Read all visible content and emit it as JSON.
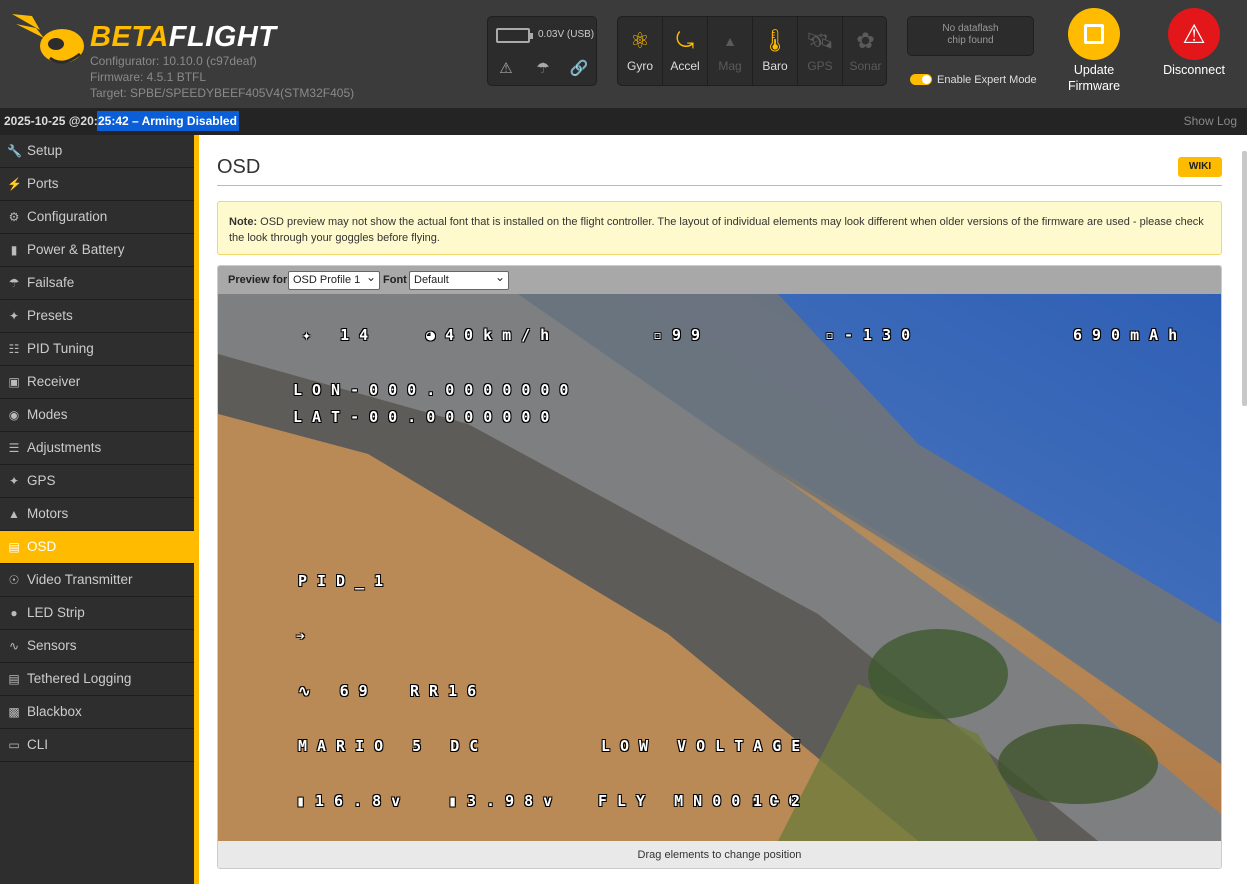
{
  "app": {
    "logo_beta": "BETA",
    "logo_flight": "FLIGHT",
    "configurator": "Configurator: 10.10.0 (c97deaf)",
    "firmware": "Firmware: 4.5.1 BTFL",
    "target": "Target: SPBE/SPEEDYBEEF405V4(STM32F405)"
  },
  "battery": {
    "voltage": "0.03V (USB)"
  },
  "sensors": [
    {
      "label": "Gyro",
      "icon": "gyro-icon",
      "active": true
    },
    {
      "label": "Accel",
      "icon": "accel-icon",
      "active": true
    },
    {
      "label": "Mag",
      "icon": "mag-icon",
      "active": false
    },
    {
      "label": "Baro",
      "icon": "baro-icon",
      "active": true
    },
    {
      "label": "GPS",
      "icon": "gps-icon",
      "active": false
    },
    {
      "label": "Sonar",
      "icon": "sonar-icon",
      "active": false
    }
  ],
  "dataflash": {
    "line1": "No dataflash",
    "line2": "chip found"
  },
  "expert_mode": {
    "label": "Enable Expert Mode",
    "enabled": true
  },
  "header_buttons": {
    "update_line1": "Update",
    "update_line2": "Firmware",
    "disconnect": "Disconnect"
  },
  "statusbar": {
    "date": "2025-10-25 @20:",
    "time_status": "25:42 – Arming Disabled",
    "show_log": "Show Log"
  },
  "sidebar": {
    "items": [
      {
        "label": "Setup",
        "icon": "wrench-icon"
      },
      {
        "label": "Ports",
        "icon": "plug-icon"
      },
      {
        "label": "Configuration",
        "icon": "gear-icon"
      },
      {
        "label": "Power & Battery",
        "icon": "battery-icon"
      },
      {
        "label": "Failsafe",
        "icon": "parachute-icon"
      },
      {
        "label": "Presets",
        "icon": "magic-icon"
      },
      {
        "label": "PID Tuning",
        "icon": "sitemap-icon"
      },
      {
        "label": "Receiver",
        "icon": "robot-icon"
      },
      {
        "label": "Modes",
        "icon": "toggle-icon"
      },
      {
        "label": "Adjustments",
        "icon": "sliders-icon"
      },
      {
        "label": "GPS",
        "icon": "satellite-icon"
      },
      {
        "label": "Motors",
        "icon": "motor-icon"
      },
      {
        "label": "OSD",
        "icon": "osd-icon",
        "active": true
      },
      {
        "label": "Video Transmitter",
        "icon": "broadcast-icon"
      },
      {
        "label": "LED Strip",
        "icon": "led-icon"
      },
      {
        "label": "Sensors",
        "icon": "pulse-icon"
      },
      {
        "label": "Tethered Logging",
        "icon": "log-icon"
      },
      {
        "label": "Blackbox",
        "icon": "blackbox-icon"
      },
      {
        "label": "CLI",
        "icon": "terminal-icon"
      }
    ]
  },
  "main": {
    "title": "OSD",
    "wiki_label": "WIKI",
    "note_bold": "Note:",
    "note_text": " OSD preview may not show the actual font that is installed on the flight controller. The layout of individual elements may look different when older versions of the firmware are used - please check the look through your goggles before flying.",
    "preview_for_label": "Preview for",
    "profile_value": "OSD Profile 1",
    "font_label": "Font",
    "font_value": "Default",
    "footer": "Drag elements to change position"
  },
  "osd_elements": {
    "sats": "14",
    "speed": "40",
    "link_quality": "99",
    "rssi_dbm": "-130",
    "mah": "690",
    "lon": "-000.0000000",
    "lat": "-00.0000000",
    "pid_profile": "PID_1",
    "throttle": "69",
    "rates": "16",
    "craft_name": "MARIO 5 DC",
    "warning": "LOW VOLTAGE",
    "main_voltage": "16.8v",
    "cell_voltage": "3.98v",
    "fly_time": "00:00",
    "pilot_count": "1-2",
    "unit_kmh": "km/h",
    "unit_mah": "mAh",
    "lon_label": "LON",
    "lat_label": "LAT",
    "rate_label": "RR",
    "fly_label": "FLY MN"
  },
  "colors": {
    "accent": "#ffbb00",
    "disconnect": "#e3171a",
    "status_highlight": "#0a5fd8"
  }
}
